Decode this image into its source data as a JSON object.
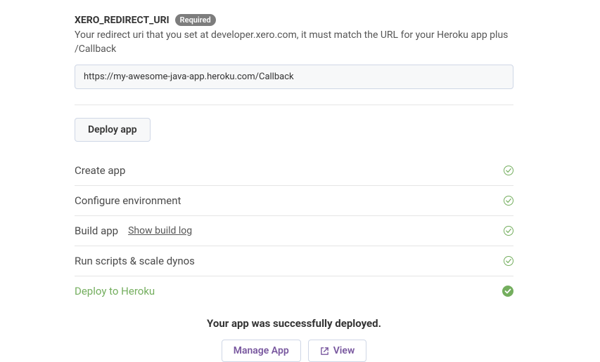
{
  "config": {
    "field_name": "XERO_REDIRECT_URI",
    "required_label": "Required",
    "description": "Your redirect uri that you set at developer.xero.com, it must match the URL for your Heroku app plus /Callback",
    "value": "https://my-awesome-java-app.heroku.com/Callback"
  },
  "deploy_button": "Deploy app",
  "steps": [
    {
      "label": "Create app",
      "status": "done"
    },
    {
      "label": "Configure environment",
      "status": "done"
    },
    {
      "label": "Build app",
      "status": "done",
      "log_link": "Show build log"
    },
    {
      "label": "Run scripts & scale dynos",
      "status": "done"
    },
    {
      "label": "Deploy to Heroku",
      "status": "success"
    }
  ],
  "success_text": "Your app was successfully deployed.",
  "actions": {
    "manage": "Manage App",
    "view": "View"
  }
}
